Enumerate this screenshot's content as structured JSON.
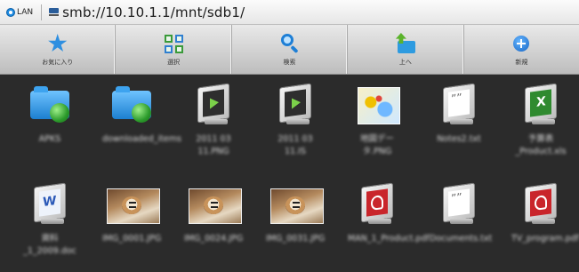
{
  "address_bar": {
    "network_label": "LAN",
    "path": "smb://10.10.1.1/mnt/sdb1/"
  },
  "toolbar": {
    "items": [
      {
        "label": "お気に入り",
        "icon": "star-icon"
      },
      {
        "label": "選択",
        "icon": "select-grid-icon"
      },
      {
        "label": "検索",
        "icon": "search-icon"
      },
      {
        "label": "上へ",
        "icon": "up-folder-icon"
      },
      {
        "label": "新規",
        "icon": "new-icon"
      }
    ]
  },
  "files": [
    {
      "name": "APKS",
      "type": "network-folder"
    },
    {
      "name": "downloaded_items",
      "type": "network-folder"
    },
    {
      "name": "2011 03 11.PNG",
      "type": "video"
    },
    {
      "name": "2011 03 11.IS",
      "type": "video"
    },
    {
      "name": "地図データ.PNG",
      "type": "map-image"
    },
    {
      "name": "Notes2.txt",
      "type": "text"
    },
    {
      "name": "予算表_Product.xls",
      "type": "excel"
    },
    {
      "name": "資料_1_2009.doc",
      "type": "word"
    },
    {
      "name": "IMG_0001.JPG",
      "type": "photo"
    },
    {
      "name": "IMG_0024.JPG",
      "type": "photo"
    },
    {
      "name": "IMG_0031.JPG",
      "type": "photo"
    },
    {
      "name": "MAN_1_Product.pdf",
      "type": "pdf"
    },
    {
      "name": "Documents.txt",
      "type": "text"
    },
    {
      "name": "TV_program.pdf",
      "type": "pdf"
    }
  ],
  "colors": {
    "background": "#2b2b2b",
    "toolbar": "#d5d5d5",
    "accent_blue": "#2f8fe0",
    "label_text": "#d8d8d8"
  }
}
